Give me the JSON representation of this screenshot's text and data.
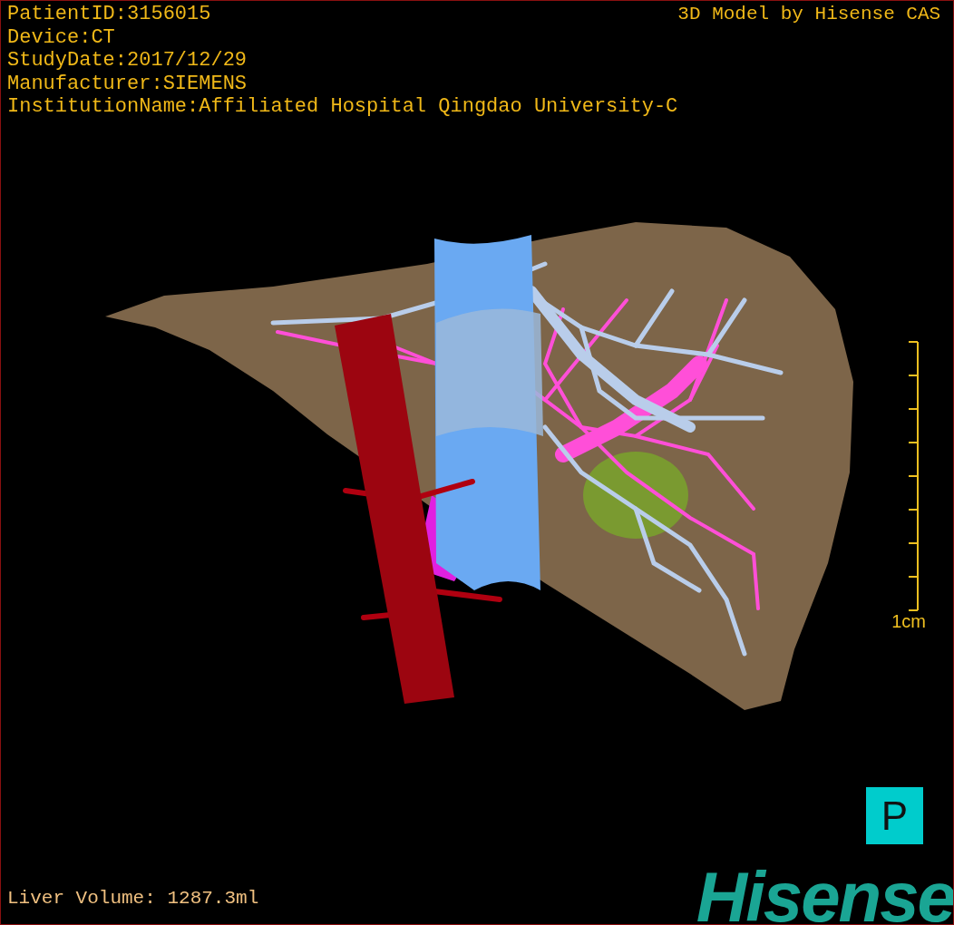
{
  "info_lines": [
    "PatientID:3156015",
    "Device:CT",
    "StudyDate:2017/12/29",
    "Manufacturer:SIEMENS",
    "InstitutionName:Affiliated Hospital Qingdao University-C"
  ],
  "credit": "3D Model by Hisense CAS",
  "scale_bar": {
    "label": "1cm"
  },
  "orientation": "P",
  "liver_volume": "Liver Volume: 1287.3ml",
  "logo": "Hisense"
}
